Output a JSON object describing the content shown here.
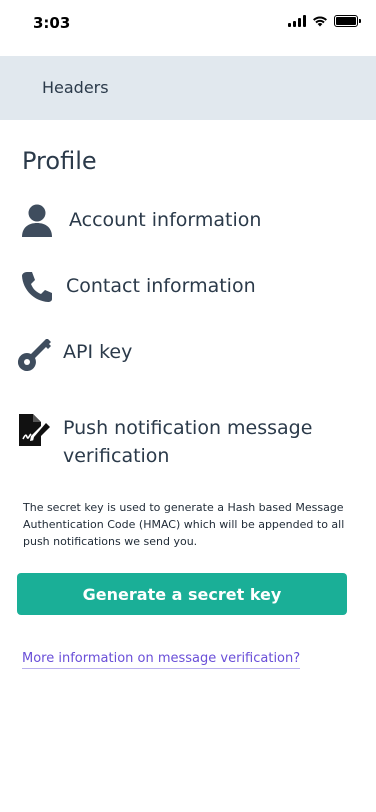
{
  "status_bar": {
    "time": "3:03",
    "icons": [
      "signal-icon",
      "wifi-icon",
      "battery-icon"
    ]
  },
  "header": {
    "title": "Headers"
  },
  "page": {
    "title": "Profile"
  },
  "menu": {
    "items": [
      {
        "label": "Account information",
        "icon": "person-icon"
      },
      {
        "label": "Contact information",
        "icon": "phone-icon"
      },
      {
        "label": "API key",
        "icon": "key-icon"
      },
      {
        "label": "Push notification message verification",
        "icon": "signature-icon"
      }
    ]
  },
  "verification": {
    "description": "The secret key is used to generate a Hash based Message Authentication Code (HMAC) which will be appended to all push notifications we send you.",
    "button_label": "Generate a secret key",
    "link_label": "More information on message verification?"
  },
  "colors": {
    "header_bg": "#e1e8ee",
    "primary": "#1aaf97",
    "link": "#6a4fd8",
    "icon": "#3f4d5e"
  }
}
